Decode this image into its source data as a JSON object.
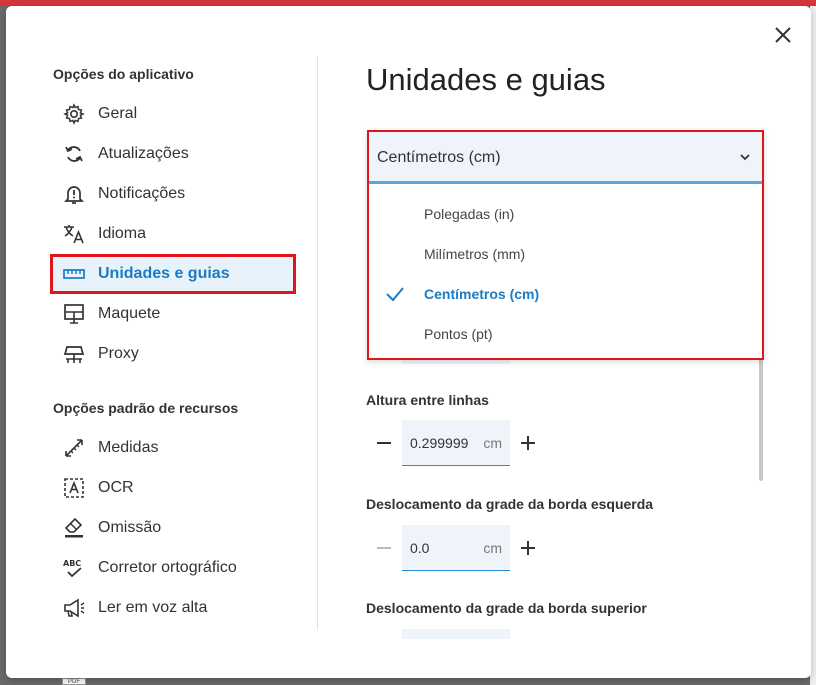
{
  "sidebar": {
    "app_section_title": "Opções do aplicativo",
    "app_items": [
      {
        "label": "Geral",
        "icon": "gear-icon"
      },
      {
        "label": "Atualizações",
        "icon": "refresh-icon"
      },
      {
        "label": "Notificações",
        "icon": "bell-alert-icon"
      },
      {
        "label": "Idioma",
        "icon": "translate-icon"
      },
      {
        "label": "Unidades e guias",
        "icon": "ruler-icon",
        "active": true
      },
      {
        "label": "Maquete",
        "icon": "layout-icon"
      },
      {
        "label": "Proxy",
        "icon": "network-icon"
      }
    ],
    "resource_section_title": "Opções padrão de recursos",
    "resource_items": [
      {
        "label": "Medidas",
        "icon": "measure-icon"
      },
      {
        "label": "OCR",
        "icon": "ocr-icon"
      },
      {
        "label": "Omissão",
        "icon": "eraser-icon"
      },
      {
        "label": "Corretor ortográfico",
        "icon": "spellcheck-icon"
      },
      {
        "label": "Ler em voz alta",
        "icon": "megaphone-icon"
      }
    ]
  },
  "main": {
    "title": "Unidades e guias",
    "units_select": {
      "selected": "Centímetros (cm)",
      "options": [
        "Polegadas (in)",
        "Milímetros (mm)",
        "Centímetros (cm)",
        "Pontos (pt)"
      ]
    },
    "line_height": {
      "label": "Altura entre linhas",
      "value": "0.299999",
      "unit": "cm"
    },
    "left_offset": {
      "label": "Deslocamento da grade da borda esquerda",
      "value": "0.0",
      "unit": "cm"
    },
    "top_offset": {
      "label": "Deslocamento da grade da borda superior"
    }
  },
  "background": {
    "pdf_label": "PDF"
  },
  "colors": {
    "accent": "#1b7bc4",
    "highlight_border": "#e0161b",
    "field_bg": "#eef4fa"
  }
}
